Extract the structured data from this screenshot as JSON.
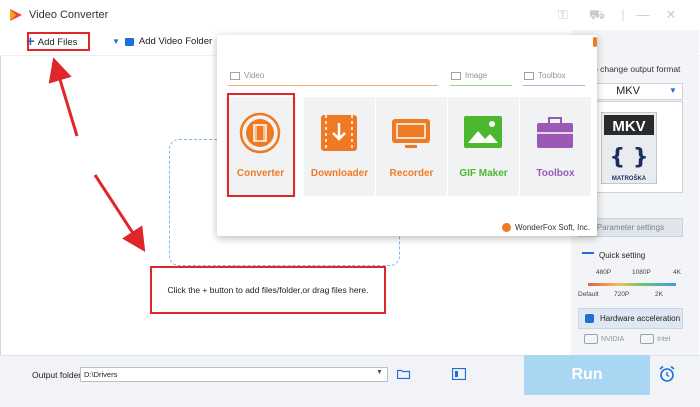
{
  "window": {
    "title": "Video Converter"
  },
  "toolbar": {
    "add_files_label": "Add Files",
    "add_folder_label": "Add Video Folder"
  },
  "home_popup": {
    "categories": [
      {
        "label": "Video"
      },
      {
        "label": "Image"
      },
      {
        "label": "Toolbox"
      }
    ],
    "tiles": [
      {
        "label": "Converter",
        "color": "#f07a23"
      },
      {
        "label": "Downloader",
        "color": "#f07a23"
      },
      {
        "label": "Recorder",
        "color": "#f07a23"
      },
      {
        "label": "GIF Maker",
        "color": "#4cb82e"
      },
      {
        "label": "Toolbox",
        "color": "#9b59b6"
      }
    ],
    "footer": "WonderFox Soft, Inc."
  },
  "drop_zone": {
    "hint": "Click the + button to add files/folder,or drag files here."
  },
  "right_panel": {
    "output_format_label": "o change output format",
    "format_value": "MKV",
    "mkv_badge_top": "MKV",
    "mkv_badge_bottom": "MATROŠKA",
    "parameter_settings_label": "Parameter settings",
    "quick_setting_label": "Quick setting",
    "quality_top": [
      "480P",
      "1080P",
      "4K"
    ],
    "quality_bottom": [
      "Default",
      "720P",
      "2K"
    ],
    "hardware_accel_label": "Hardware acceleration",
    "gpu_nvidia": "NVIDIA",
    "gpu_intel": "Intel"
  },
  "bottom_bar": {
    "output_folder_label": "Output folder:",
    "output_folder_value": "D:\\Drivers",
    "run_label": "Run"
  },
  "colors": {
    "accent": "#1e6fd6",
    "annotation": "#e0262b",
    "run": "#a9d6f2"
  }
}
